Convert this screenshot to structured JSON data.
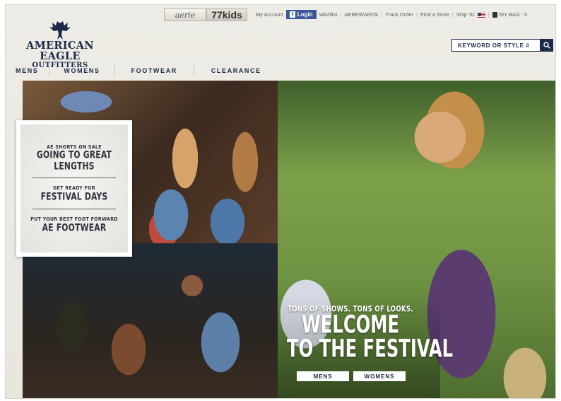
{
  "topbar": {
    "brands": [
      "aerie",
      "77kids"
    ],
    "links": [
      "My Account",
      "Wishlist",
      "AEREWARDS",
      "Track Order",
      "Find a Store"
    ],
    "login_label": "Login",
    "ship_to_label": "Ship To:",
    "bag_label": "MY BAG : 0"
  },
  "logo": {
    "line1": "AMERICAN EAGLE",
    "line2": "OUTFITTERS"
  },
  "search": {
    "placeholder": "KEYWORD OR STYLE #"
  },
  "nav": {
    "items": [
      "MENS",
      "WOMENS",
      "FOOTWEAR",
      "CLEARANCE"
    ]
  },
  "promo": {
    "blocks": [
      {
        "small": "AE SHORTS ON SALE",
        "large": "GOING TO GREAT LENGTHS"
      },
      {
        "small": "GET READY FOR",
        "large": "FESTIVAL DAYS"
      },
      {
        "small": "PUT YOUR BEST FOOT FORWARD",
        "large": "AE FOOTWEAR"
      }
    ]
  },
  "festival": {
    "subtitle": "TONS OF SHOWS. TONS OF LOOKS.",
    "headline_line1": "WELCOME",
    "headline_line2": "TO THE FESTIVAL",
    "buttons": [
      "MENS",
      "WOMENS"
    ]
  },
  "colors": {
    "brand_navy": "#1b2a4a",
    "facebook_blue": "#3b5998",
    "header_bg": "#eeece6"
  },
  "icons": [
    "eagle-logo-icon",
    "facebook-icon",
    "us-flag-icon",
    "bag-icon",
    "search-icon"
  ]
}
